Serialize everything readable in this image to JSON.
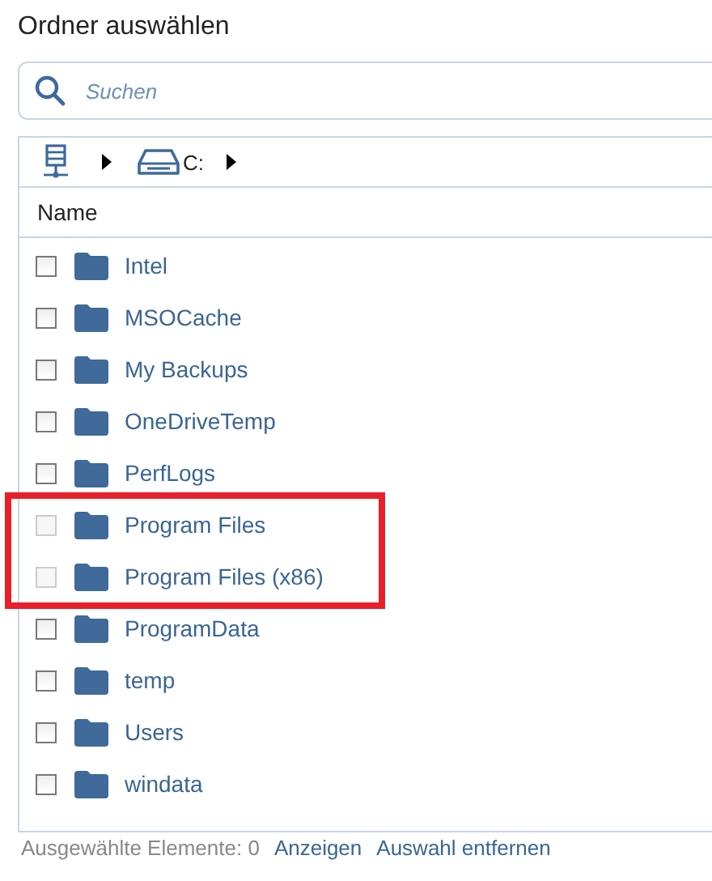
{
  "title": "Ordner auswählen",
  "search": {
    "placeholder": "Suchen"
  },
  "breadcrumb": {
    "drive": "C:"
  },
  "table": {
    "columns": [
      "Name"
    ],
    "rows": [
      {
        "name": "Intel",
        "checked": false,
        "disabled": false,
        "highlighted": false
      },
      {
        "name": "MSOCache",
        "checked": false,
        "disabled": false,
        "highlighted": false
      },
      {
        "name": "My Backups",
        "checked": false,
        "disabled": false,
        "highlighted": false
      },
      {
        "name": "OneDriveTemp",
        "checked": false,
        "disabled": false,
        "highlighted": false
      },
      {
        "name": "PerfLogs",
        "checked": false,
        "disabled": false,
        "highlighted": false
      },
      {
        "name": "Program Files",
        "checked": false,
        "disabled": true,
        "highlighted": true
      },
      {
        "name": "Program Files (x86)",
        "checked": false,
        "disabled": true,
        "highlighted": true
      },
      {
        "name": "ProgramData",
        "checked": false,
        "disabled": false,
        "highlighted": false
      },
      {
        "name": "temp",
        "checked": false,
        "disabled": false,
        "highlighted": false
      },
      {
        "name": "Users",
        "checked": false,
        "disabled": false,
        "highlighted": false
      },
      {
        "name": "windata",
        "checked": false,
        "disabled": false,
        "highlighted": false
      }
    ]
  },
  "status_bar": {
    "selected_count": "Ausgewählte Elemente: 0",
    "links": [
      "Anzeigen",
      "Auswahl entfernen"
    ]
  }
}
